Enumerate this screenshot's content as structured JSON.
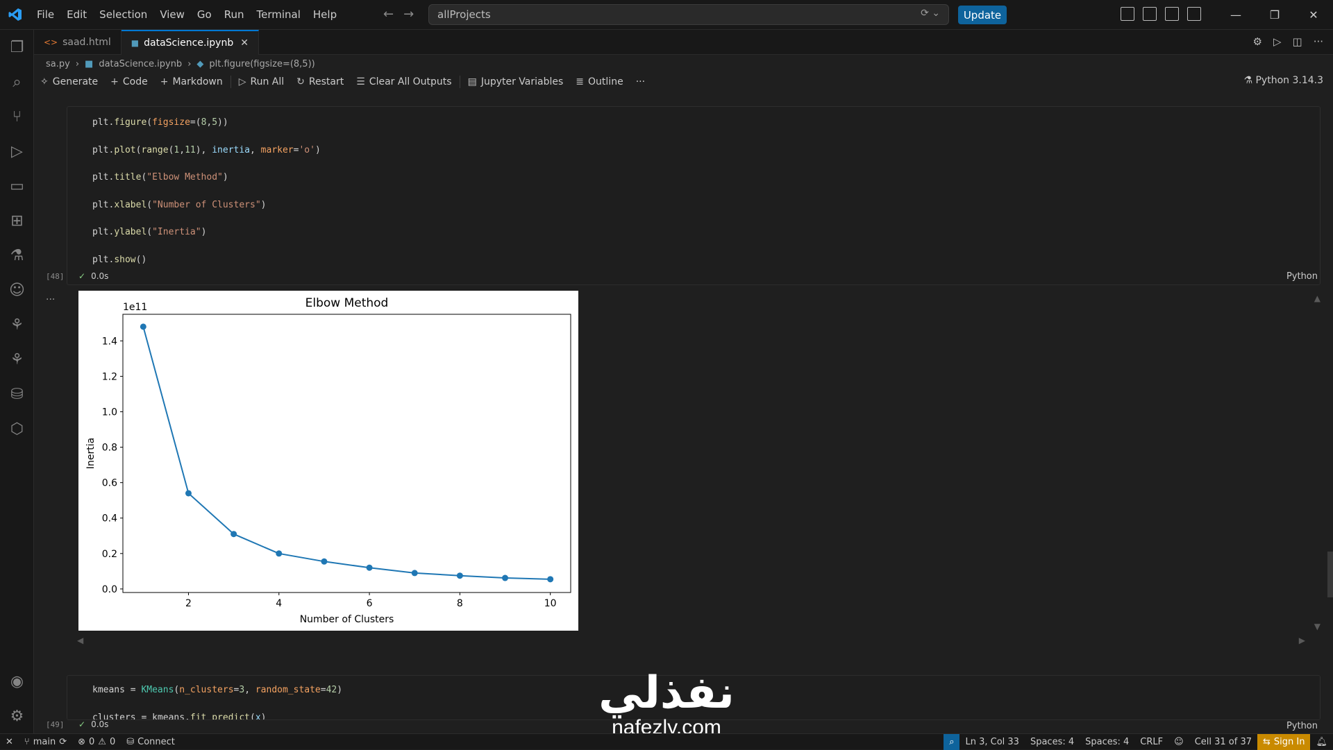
{
  "menu": [
    "File",
    "Edit",
    "Selection",
    "View",
    "Go",
    "Run",
    "Terminal",
    "Help"
  ],
  "command_center": {
    "text": "allProjects"
  },
  "update_label": "Update",
  "tabs": [
    {
      "label": "saad.html",
      "icon": "html-file-icon",
      "active": false
    },
    {
      "label": "dataScience.ipynb",
      "icon": "notebook-file-icon",
      "active": true
    }
  ],
  "breadcrumb": [
    "sa.py",
    "dataScience.ipynb",
    "plt.figure(figsize=(8,5))"
  ],
  "toolbar": {
    "generate": "Generate",
    "code": "Code",
    "markdown": "Markdown",
    "run_all": "Run All",
    "restart": "Restart",
    "clear": "Clear All Outputs",
    "variables": "Jupyter Variables",
    "outline": "Outline",
    "more": "···"
  },
  "kernel": "Python 3.14.3",
  "cell48": {
    "exec": "[48]",
    "time": "0.0s",
    "lang": "Python",
    "lines": [
      "plt.figure(figsize=(8,5))",
      "plt.plot(range(1,11), inertia, marker='o')",
      "plt.title(\"Elbow Method\")",
      "plt.xlabel(\"Number of Clusters\")",
      "plt.ylabel(\"Inertia\")",
      "plt.show()"
    ]
  },
  "cell49": {
    "exec": "[49]",
    "time": "0.0s",
    "lang": "Python",
    "lines": [
      "kmeans = KMeans(n_clusters=3, random_state=42)",
      "clusters = kmeans.fit_predict(x)"
    ]
  },
  "output_dots": "...",
  "chart_data": {
    "type": "line",
    "title": "Elbow Method",
    "xlabel": "Number of Clusters",
    "ylabel": "Inertia",
    "y_offset_label": "1e11",
    "x": [
      1,
      2,
      3,
      4,
      5,
      6,
      7,
      8,
      9,
      10
    ],
    "series": [
      {
        "values": [
          1.48,
          0.54,
          0.31,
          0.2,
          0.155,
          0.12,
          0.09,
          0.075,
          0.062,
          0.055
        ]
      }
    ],
    "xlim": [
      0.55,
      10.45
    ],
    "ylim": [
      -0.02,
      1.55
    ],
    "xticks": [
      2,
      4,
      6,
      8,
      10
    ],
    "yticks": [
      0.0,
      0.2,
      0.4,
      0.6,
      0.8,
      1.0,
      1.2,
      1.4
    ],
    "color": "#1f77b4",
    "grid": false
  },
  "status": {
    "branch": "main",
    "errors": "0",
    "warnings": "0",
    "connect": "Connect",
    "position": "Ln 3, Col 33",
    "spaces1": "Spaces: 4",
    "spaces2": "Spaces: 4",
    "eol": "CRLF",
    "cell": "Cell 31 of 37",
    "signin": "Sign In"
  },
  "watermark": {
    "arabic": "نفذلي",
    "latin": "nafezly.com"
  }
}
